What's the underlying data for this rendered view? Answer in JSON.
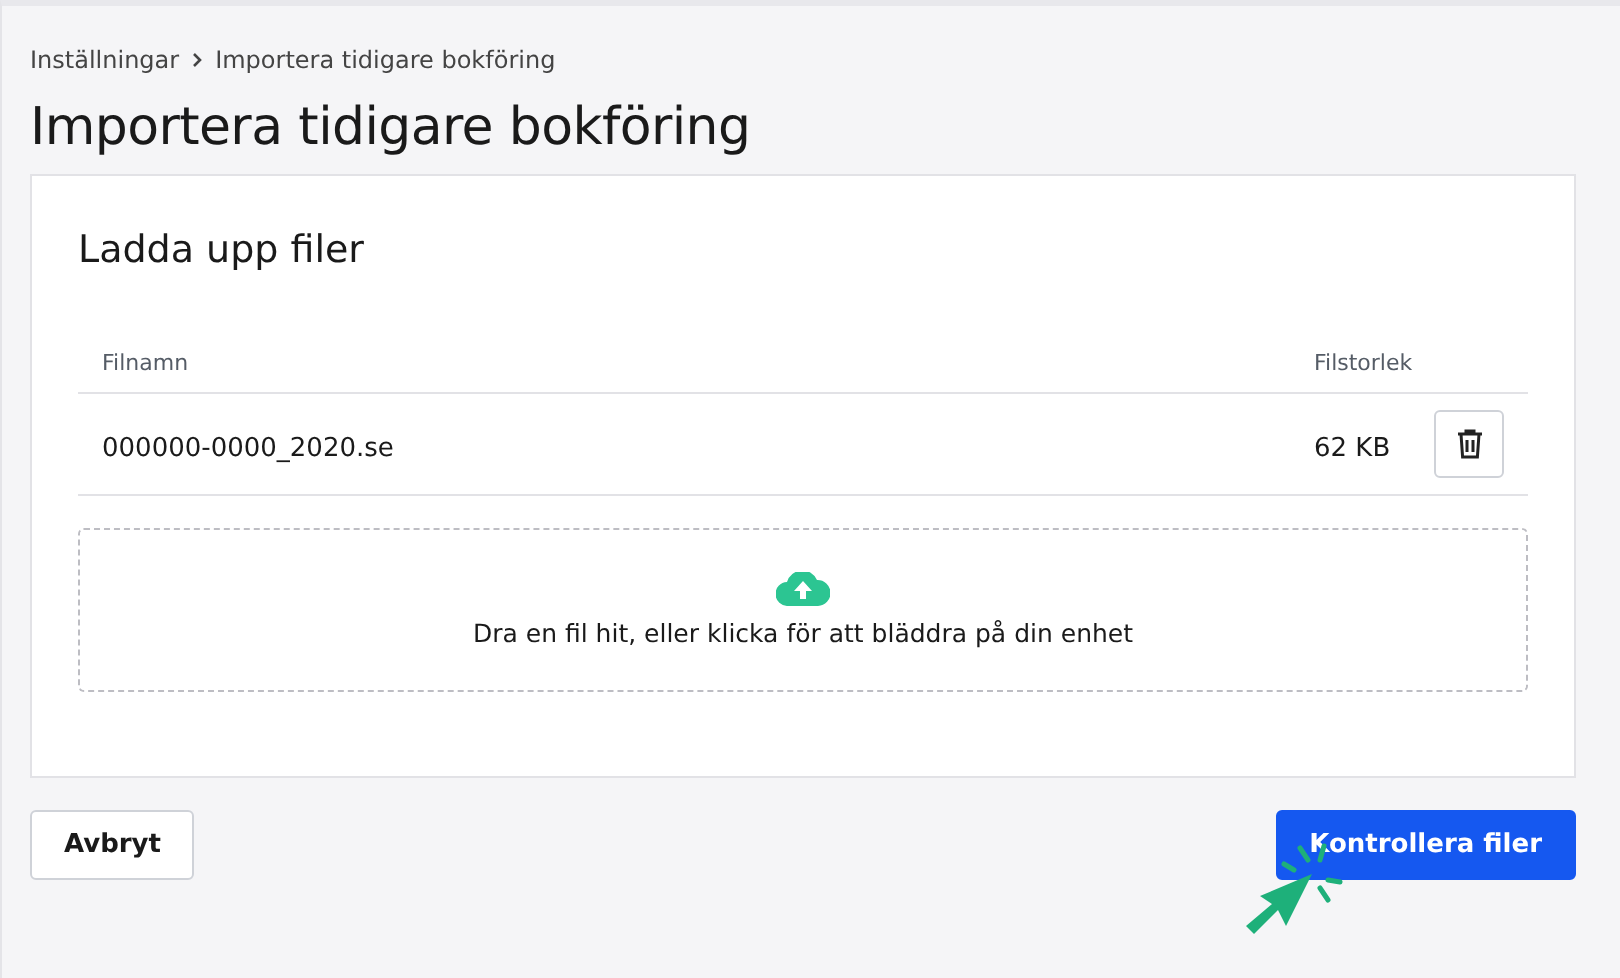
{
  "breadcrumb": [
    {
      "label": "Inställningar"
    },
    {
      "label": "Importera tidigare bokföring"
    }
  ],
  "title": "Importera tidigare bokföring",
  "card": {
    "title": "Ladda upp filer",
    "table": {
      "columns": [
        "Filnamn",
        "Filstorlek"
      ],
      "rows": [
        {
          "name": "000000-0000_2020.se",
          "size": "62 KB"
        }
      ]
    },
    "dropzone": {
      "text": "Dra en fil hit, eller klicka för att bläddra på din enhet"
    }
  },
  "buttons": [
    {
      "label": "Avbryt",
      "kind": "secondary"
    },
    {
      "label": "Kontrollera filer",
      "kind": "primary"
    }
  ]
}
